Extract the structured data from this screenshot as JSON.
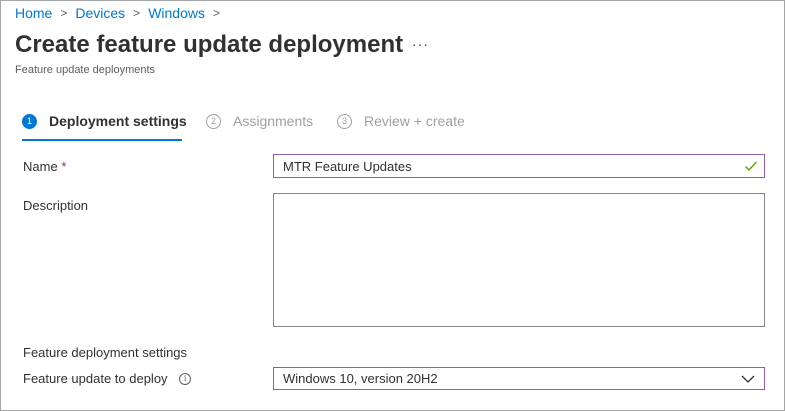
{
  "breadcrumb": {
    "items": [
      "Home",
      "Devices",
      "Windows"
    ],
    "separator": ">"
  },
  "header": {
    "title": "Create feature update deployment",
    "more": "···",
    "subtitle": "Feature update deployments"
  },
  "wizard": {
    "steps": [
      {
        "number": "1",
        "label": "Deployment settings",
        "state": "active"
      },
      {
        "number": "2",
        "label": "Assignments",
        "state": "inactive"
      },
      {
        "number": "3",
        "label": "Review + create",
        "state": "inactive"
      }
    ]
  },
  "form": {
    "name_label": "Name",
    "name_required": "*",
    "name_value": "MTR Feature Updates",
    "description_label": "Description",
    "description_value": "",
    "section_heading": "Feature deployment settings",
    "feature_label": "Feature update to deploy",
    "feature_info": "i",
    "feature_value": "Windows 10, version 20H2"
  },
  "colors": {
    "accent": "#0078d4",
    "focused_border": "#8a5fb6",
    "valid_check": "#57a300"
  }
}
